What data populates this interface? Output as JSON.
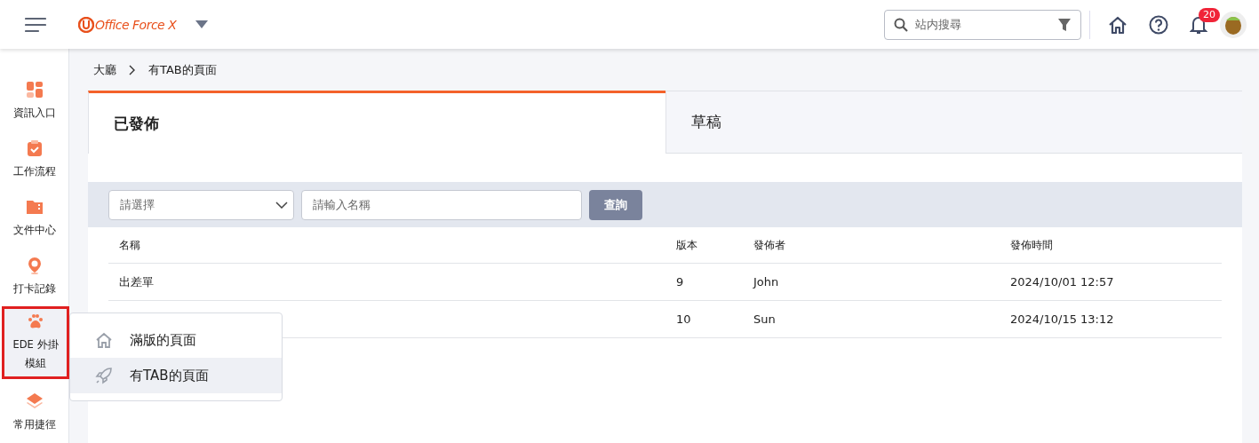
{
  "header": {
    "logo": "Office Force X",
    "search": {
      "placeholder": "站内搜尋"
    },
    "notifications": {
      "count": "20"
    }
  },
  "sidebar": {
    "items": [
      {
        "label": "資訊入口",
        "selected": false
      },
      {
        "label": "工作流程",
        "selected": false
      },
      {
        "label": "文件中心",
        "selected": false
      },
      {
        "label": "打卡記錄",
        "selected": false
      },
      {
        "label": "EDE 外掛模組",
        "selected": true
      },
      {
        "label": "常用捷徑",
        "selected": false
      }
    ]
  },
  "breadcrumb": [
    "大廳",
    "有TAB的頁面"
  ],
  "tabs": [
    {
      "label": "已發佈",
      "selected": true
    },
    {
      "label": "草稿",
      "selected": false
    }
  ],
  "filter": {
    "select": {
      "placeholder": "請選擇"
    },
    "name": {
      "placeholder": "請輸入名稱"
    },
    "button": "查詢"
  },
  "table": {
    "columns": [
      "名稱",
      "版本",
      "發佈者",
      "發佈時間"
    ],
    "rows": [
      {
        "cells": [
          "出差單",
          "9",
          "John",
          "2024/10/01 12:57"
        ]
      },
      {
        "cells": [
          "",
          "10",
          "Sun",
          "2024/10/15 13:12"
        ]
      }
    ]
  },
  "submenu": {
    "items": [
      {
        "label": "滿版的頁面",
        "selected": false
      },
      {
        "label": "有TAB的頁面",
        "selected": true
      }
    ]
  }
}
